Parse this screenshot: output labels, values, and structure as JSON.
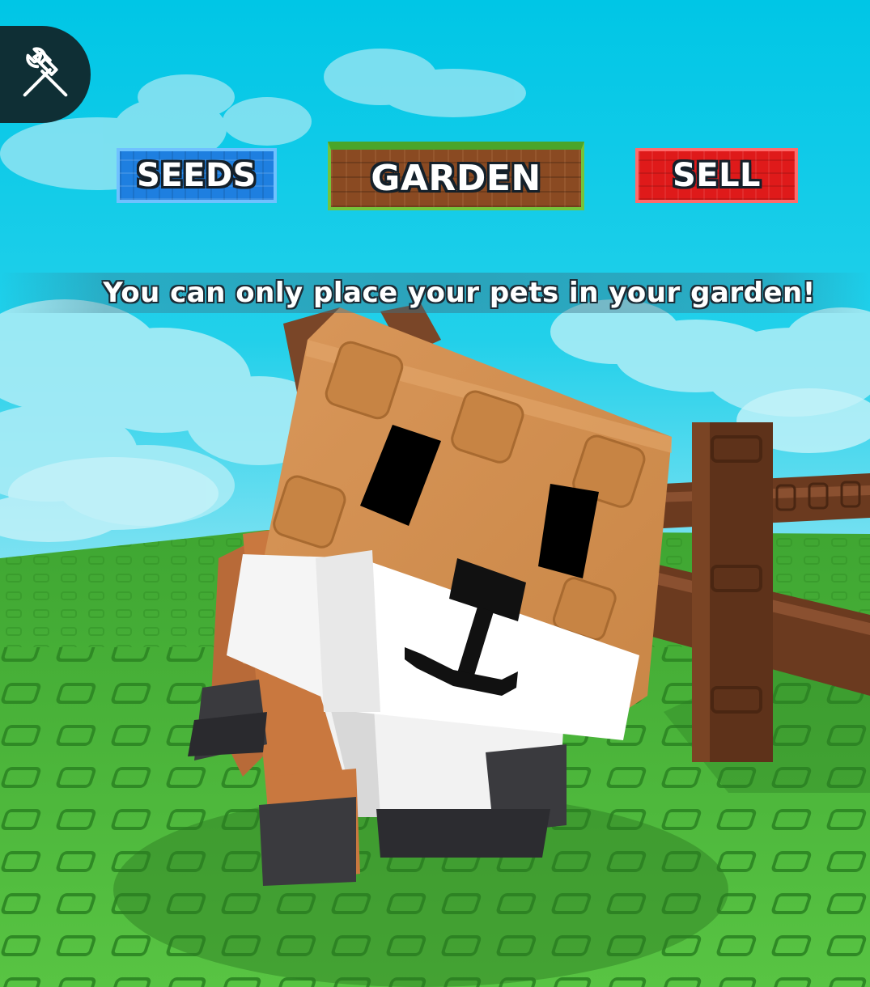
{
  "toolbar": {
    "tools_icon": "hammer-wrench-icon",
    "buttons": {
      "seeds": "SEEDS",
      "garden": "GARDEN",
      "sell": "SELL"
    }
  },
  "notification": {
    "message": "You can only place your pets in your garden!"
  },
  "scene": {
    "pet": "fox-pet",
    "props": [
      "wooden-fence"
    ],
    "ground": "green-studded-baseplate",
    "sky": "blue-sky-with-clouds"
  },
  "colors": {
    "sky": "#00c8e8",
    "grass": "#4cb63a",
    "seeds_button": "#1e7fe0",
    "garden_button": "#8a4a22",
    "sell_button": "#df1a1a",
    "fox_orange": "#d39050",
    "fence_brown": "#6b3a1f"
  }
}
